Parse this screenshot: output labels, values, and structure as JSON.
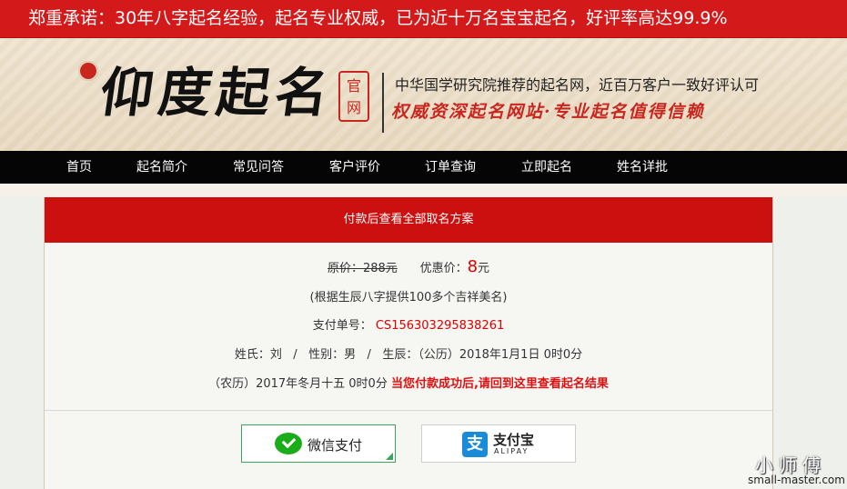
{
  "promo_banner": {
    "text": "郑重承诺：30年八字起名经验，起名专业权威，已为近十万名宝宝起名，好评率高达99.9%"
  },
  "header": {
    "logo_text": "仰度起名",
    "official_stamp": "官网",
    "slogan_line1": "中华国学研究院推荐的起名网，近百万客户一致好评认可",
    "slogan_line2": "权威资深起名网站·专业起名值得信赖"
  },
  "nav": {
    "items": [
      {
        "label": "首页"
      },
      {
        "label": "起名简介"
      },
      {
        "label": "常见问答"
      },
      {
        "label": "客户评价"
      },
      {
        "label": "订单查询"
      },
      {
        "label": "立即起名"
      },
      {
        "label": "姓名详批"
      }
    ]
  },
  "order_panel": {
    "title": "付款后查看全部取名方案",
    "original_price_label": "原价：288元",
    "sale_price_label": "优惠价：",
    "sale_price_value": "8",
    "sale_price_unit": "元",
    "description": "(根据生辰八字提供100多个吉祥美名)",
    "order_no_label": "支付单号：",
    "order_no_value": "CS156303295838261",
    "surname_label": "姓氏：刘",
    "divider": "/",
    "gender_label": "性别：男",
    "birth_label": "生辰：（公历）2018年1月1日 0时0分",
    "lunar_label": "（农历）2017年冬月十五 0时0分",
    "notice": "当您付款成功后,请回到这里查看起名结果"
  },
  "payment": {
    "wechat_label": "微信支付",
    "alipay_cn": "支付宝",
    "alipay_en": "ALIPAY",
    "alipay_glyph": "支"
  },
  "watermark": {
    "cn": "小师傅",
    "en": "small-master.com"
  },
  "colors": {
    "brand_red": "#d4191a",
    "nav_bg": "#050505",
    "price_red": "#dd0000",
    "wechat_green": "#1aad19",
    "alipay_blue": "#1a8bd8"
  }
}
